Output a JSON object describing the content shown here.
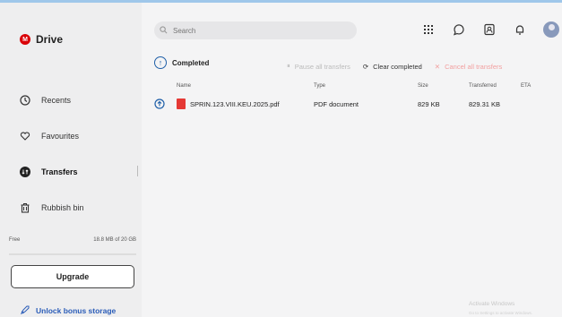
{
  "app": {
    "name": "Drive",
    "logo_letter": "M"
  },
  "search": {
    "placeholder": "Search"
  },
  "sidebar": {
    "items": [
      {
        "label": "Recents",
        "icon": "clock-icon"
      },
      {
        "label": "Favourites",
        "icon": "heart-icon"
      },
      {
        "label": "Transfers",
        "icon": "transfer-icon",
        "active": true
      },
      {
        "label": "Rubbish bin",
        "icon": "trash-icon"
      }
    ],
    "storage_plan": "Free",
    "storage_used": "18.8 MB of 20 GB",
    "upgrade_label": "Upgrade",
    "bonus_label": "Unlock bonus storage"
  },
  "transfers": {
    "section_title": "Completed",
    "actions": {
      "pause_all": "Pause all transfers",
      "clear_completed": "Clear completed",
      "cancel_all": "Cancel all transfers"
    },
    "columns": [
      "Name",
      "Type",
      "Size",
      "Transferred",
      "ETA"
    ],
    "rows": [
      {
        "name": "SPRIN.123.VIII.KEU.2025.pdf",
        "type": "PDF document",
        "size": "829 KB",
        "transferred": "829.31 KB",
        "eta": ""
      }
    ]
  },
  "watermark": {
    "title": "Activate Windows",
    "subtitle": "Go to Settings to activate Windows."
  },
  "colors": {
    "brand": "#d90007",
    "accent": "#1f5fa8",
    "link": "#2a5cb8"
  }
}
